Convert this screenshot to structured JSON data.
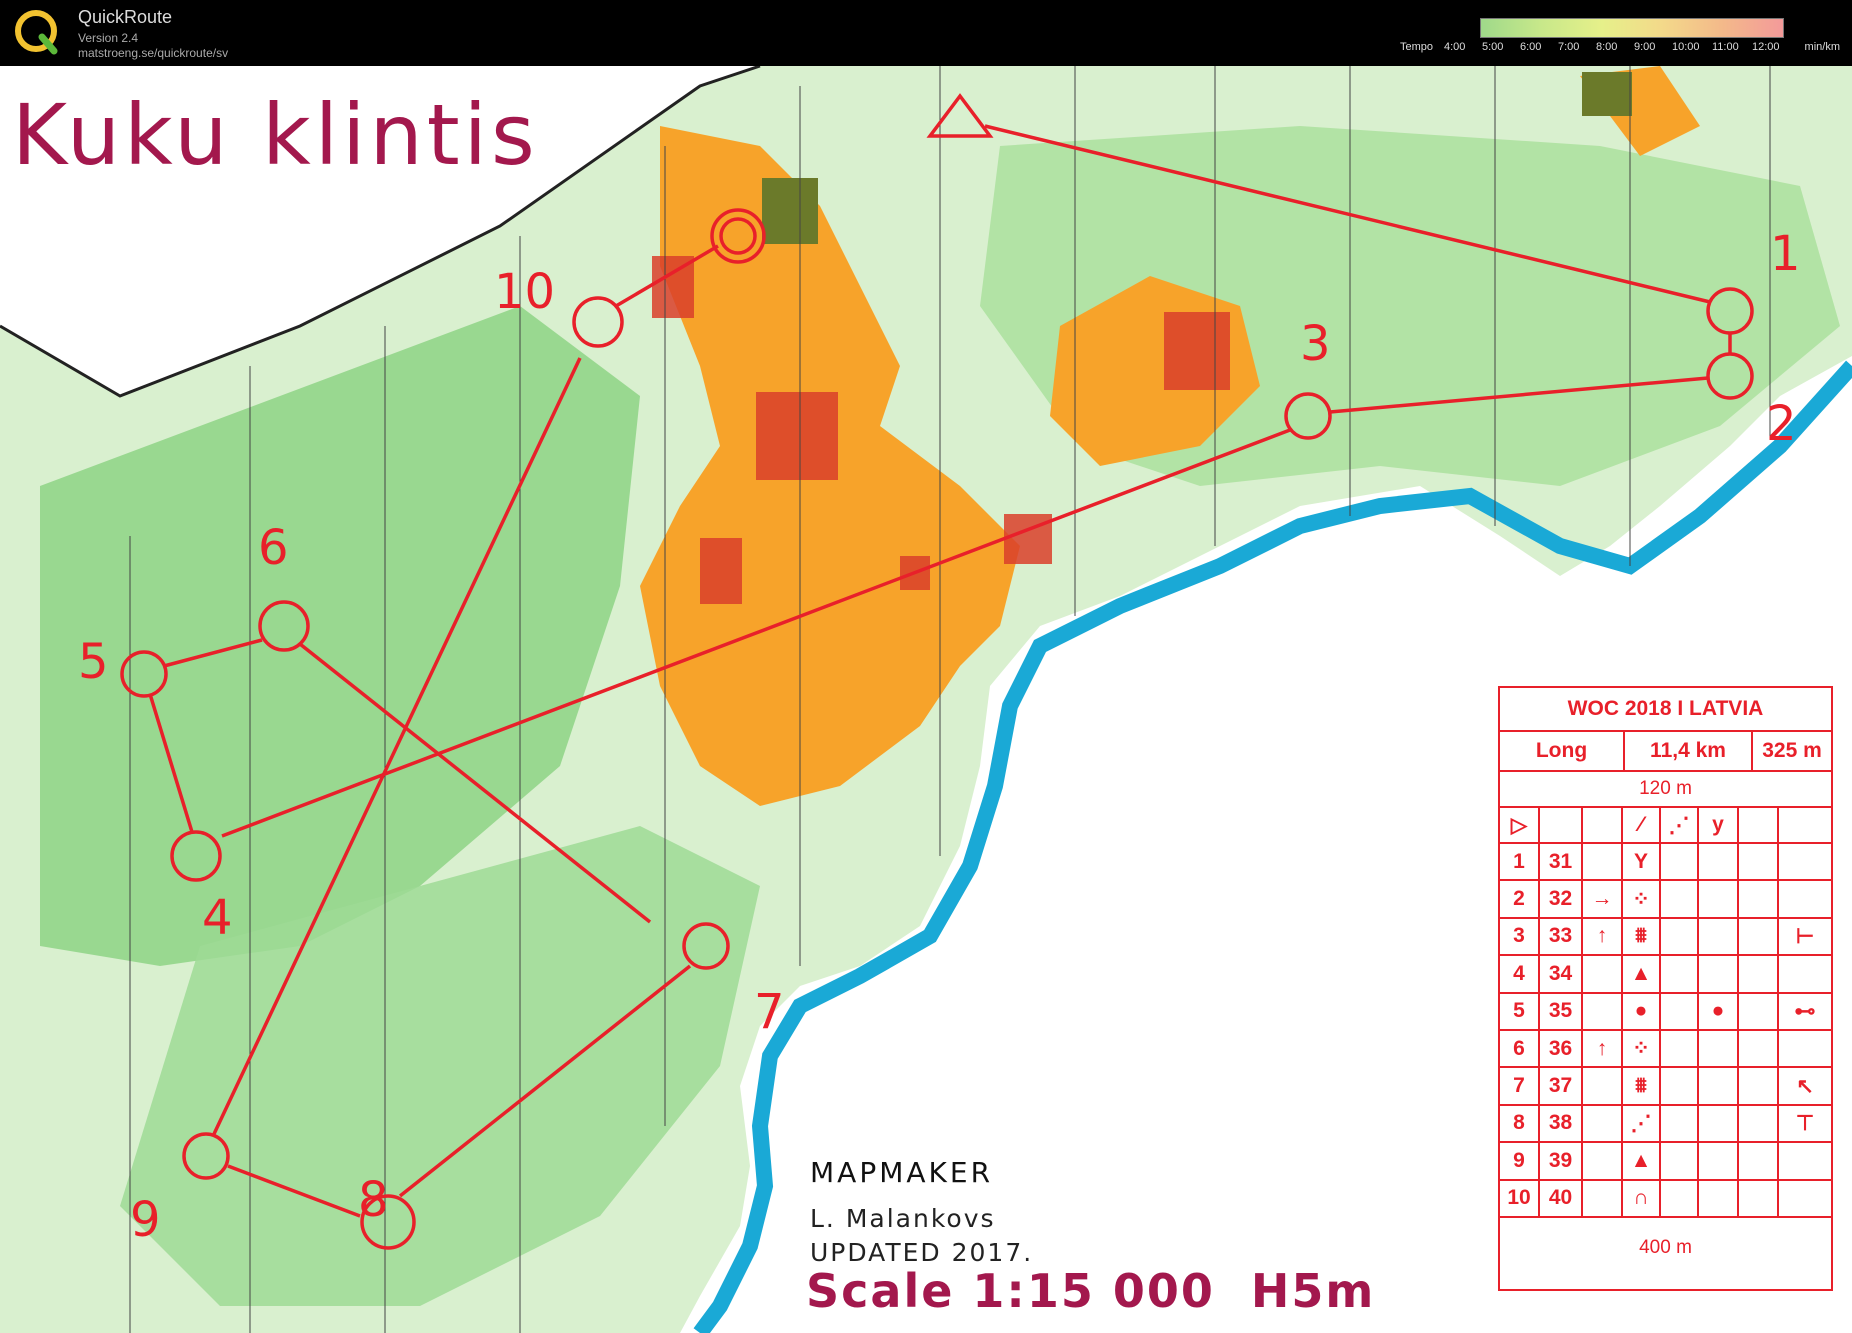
{
  "app": {
    "name": "QuickRoute",
    "version": "Version 2.4",
    "url": "matstroeng.se/quickroute/sv"
  },
  "tempo_legend": {
    "label": "Tempo",
    "ticks": [
      "4:00",
      "5:00",
      "6:00",
      "7:00",
      "8:00",
      "9:00",
      "10:00",
      "11:00",
      "12:00"
    ],
    "unit": "min/km",
    "gradient_colors": [
      "#9fd98a",
      "#c8e88a",
      "#e6f08a",
      "#f3d98a",
      "#f3b98a",
      "#f39a9a"
    ]
  },
  "map": {
    "title": "Kuku klintis",
    "control_numbers": [
      "1",
      "2",
      "3",
      "4",
      "5",
      "6",
      "7",
      "8",
      "9",
      "10"
    ],
    "mapmaker_heading": "MAPMAKER",
    "mapmaker_name": "L. Malankovs",
    "updated": "UPDATED 2017.",
    "scale": "Scale 1:15 000  H5m",
    "colors": {
      "course": "#e8202a",
      "title": "#a3184d",
      "open_land": "#f7a32a",
      "vegetation": "#7fd17a",
      "river": "#1aa9d6",
      "settlement": "#6b7a2a"
    }
  },
  "control_descriptions": {
    "event": "WOC 2018 I LATVIA",
    "course_class": "Long",
    "length": "11,4 km",
    "climb": "325 m",
    "start_to_first_distance": "120 m",
    "finish_distance": "400 m",
    "rows": [
      {
        "num": "1",
        "code": "31",
        "dir": "",
        "feature": "Y",
        "appearance": "",
        "location": ""
      },
      {
        "num": "2",
        "code": "32",
        "dir": "→",
        "feature": "⁘",
        "appearance": "",
        "location": ""
      },
      {
        "num": "3",
        "code": "33",
        "dir": "↑",
        "feature": "⩩",
        "appearance": "",
        "location": "⊢"
      },
      {
        "num": "4",
        "code": "34",
        "dir": "",
        "feature": "▲",
        "appearance": "",
        "location": ""
      },
      {
        "num": "5",
        "code": "35",
        "dir": "",
        "feature": "●",
        "appearance": "●",
        "location": "⊷"
      },
      {
        "num": "6",
        "code": "36",
        "dir": "↑",
        "feature": "⁘",
        "appearance": "",
        "location": ""
      },
      {
        "num": "7",
        "code": "37",
        "dir": "",
        "feature": "⩩",
        "appearance": "",
        "location": "↖"
      },
      {
        "num": "8",
        "code": "38",
        "dir": "",
        "feature": "⋰",
        "appearance": "",
        "location": "⊤"
      },
      {
        "num": "9",
        "code": "39",
        "dir": "",
        "feature": "▲",
        "appearance": "",
        "location": ""
      },
      {
        "num": "10",
        "code": "40",
        "dir": "",
        "feature": "∩",
        "appearance": "",
        "location": ""
      }
    ]
  }
}
